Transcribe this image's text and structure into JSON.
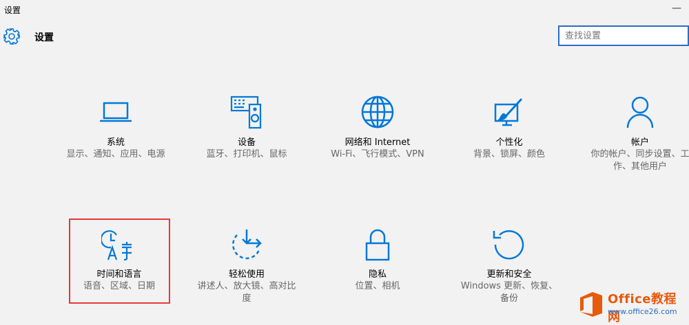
{
  "window": {
    "title": "设置",
    "minimize_glyph": "—"
  },
  "header": {
    "title": "设置",
    "icon": "gear-icon"
  },
  "search": {
    "placeholder": "查找设置",
    "value": ""
  },
  "colors": {
    "accent": "#0078d7",
    "highlight_border": "#e53935",
    "background": "#f2f2f2"
  },
  "tiles": [
    {
      "label": "系统",
      "sub": "显示、通知、应用、电源",
      "icon": "laptop-icon"
    },
    {
      "label": "设备",
      "sub": "蓝牙、打印机、鼠标",
      "icon": "devices-icon"
    },
    {
      "label": "网络和 Internet",
      "sub": "Wi-Fi、飞行模式、VPN",
      "icon": "globe-icon"
    },
    {
      "label": "个性化",
      "sub": "背景、锁屏、颜色",
      "icon": "paint-monitor-icon"
    },
    {
      "label": "帐户",
      "sub": "你的帐户、同步设置、工作、其他用户",
      "icon": "person-icon"
    },
    {
      "label": "时间和语言",
      "sub": "语音、区域、日期",
      "icon": "time-language-icon"
    },
    {
      "label": "轻松使用",
      "sub": "讲述人、放大镜、高对比度",
      "icon": "ease-of-access-icon"
    },
    {
      "label": "隐私",
      "sub": "位置、相机",
      "icon": "lock-icon"
    },
    {
      "label": "更新和安全",
      "sub": "Windows 更新、恢复、备份",
      "icon": "refresh-icon"
    }
  ],
  "watermark": {
    "brand": "Office教程网",
    "url": "www.office26.com"
  }
}
